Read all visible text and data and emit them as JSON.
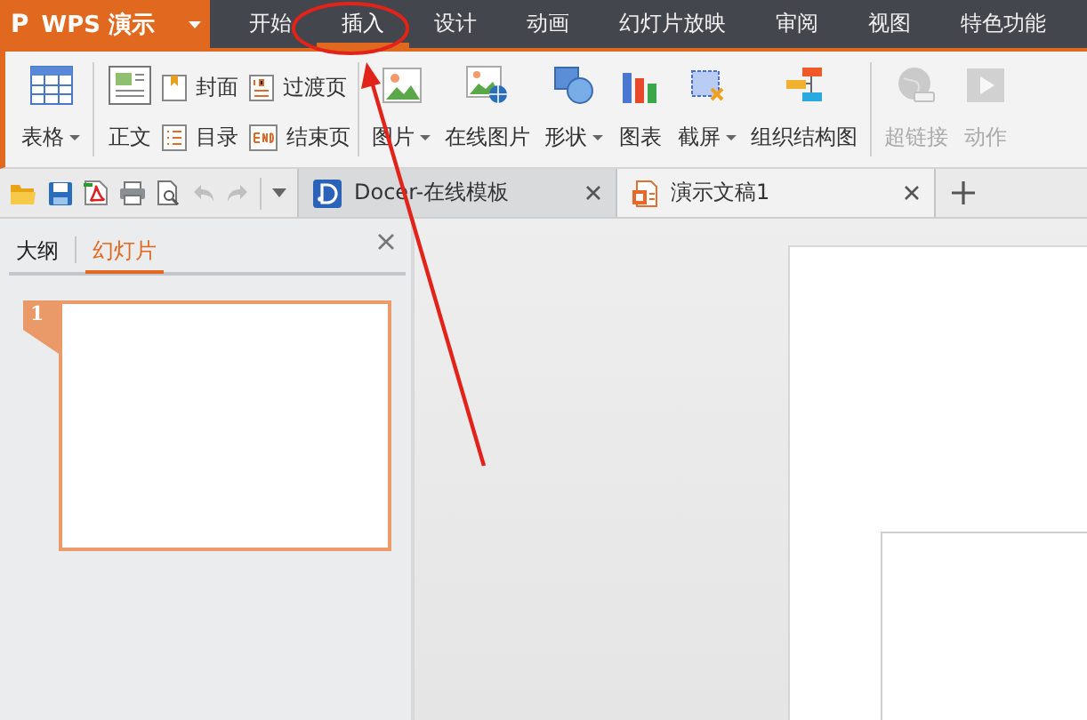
{
  "app_button": {
    "logo": "P",
    "label": "WPS 演示"
  },
  "menu_tabs": [
    {
      "label": "开始",
      "selected": false
    },
    {
      "label": "插入",
      "selected": true
    },
    {
      "label": "设计",
      "selected": false
    },
    {
      "label": "动画",
      "selected": false
    },
    {
      "label": "幻灯片放映",
      "selected": false
    },
    {
      "label": "审阅",
      "selected": false
    },
    {
      "label": "视图",
      "selected": false
    },
    {
      "label": "特色功能",
      "selected": false
    }
  ],
  "ribbon": {
    "groups": [
      {
        "items": [
          {
            "kind": "large",
            "label": "表格",
            "dropdown": true,
            "disabled": false
          }
        ]
      },
      {
        "items": [
          {
            "kind": "large",
            "label": "正文",
            "dropdown": false,
            "disabled": false
          },
          {
            "kind": "small",
            "label": "封面",
            "disabled": false
          },
          {
            "kind": "small",
            "label": "目录",
            "disabled": false
          },
          {
            "kind": "small",
            "label": "过渡页",
            "disabled": false
          },
          {
            "kind": "small",
            "label": "结束页",
            "disabled": false
          }
        ]
      },
      {
        "items": [
          {
            "kind": "large",
            "label": "图片",
            "dropdown": true,
            "disabled": false
          },
          {
            "kind": "large",
            "label": "在线图片",
            "dropdown": false,
            "disabled": false
          },
          {
            "kind": "large",
            "label": "形状",
            "dropdown": true,
            "disabled": false
          },
          {
            "kind": "large",
            "label": "图表",
            "dropdown": false,
            "disabled": false
          },
          {
            "kind": "large",
            "label": "截屏",
            "dropdown": true,
            "disabled": false
          },
          {
            "kind": "large",
            "label": "组织结构图",
            "dropdown": false,
            "disabled": false
          }
        ]
      },
      {
        "items": [
          {
            "kind": "large",
            "label": "超链接",
            "dropdown": false,
            "disabled": true
          },
          {
            "kind": "large",
            "label": "动作",
            "dropdown": false,
            "disabled": true
          }
        ]
      }
    ]
  },
  "doc_tabs": [
    {
      "title": "Docer-在线模板",
      "selected": false
    },
    {
      "title": "演示文稿1",
      "selected": true
    }
  ],
  "side_panel": {
    "tabs": [
      {
        "label": "大纲",
        "selected": false
      },
      {
        "label": "幻灯片",
        "selected": true
      }
    ],
    "slides": [
      {
        "number": "1",
        "selected": true
      }
    ]
  }
}
